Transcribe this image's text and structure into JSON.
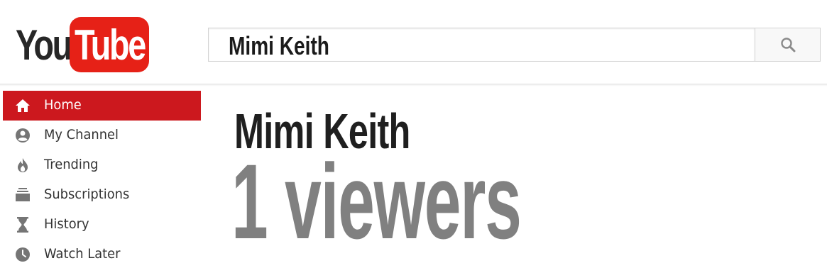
{
  "logo": {
    "you": "You",
    "tube": "Tube"
  },
  "search": {
    "value": "Mimi Keith",
    "button_icon": "search-icon"
  },
  "sidebar": {
    "items": [
      {
        "label": "Home",
        "icon": "home-icon",
        "active": true
      },
      {
        "label": "My Channel",
        "icon": "account-icon",
        "active": false
      },
      {
        "label": "Trending",
        "icon": "flame-icon",
        "active": false
      },
      {
        "label": "Subscriptions",
        "icon": "subscriptions-icon",
        "active": false
      },
      {
        "label": "History",
        "icon": "hourglass-icon",
        "active": false
      },
      {
        "label": "Watch Later",
        "icon": "clock-icon",
        "active": false
      }
    ]
  },
  "main": {
    "channel_name": "Mimi Keith",
    "viewers": "1 viewers"
  },
  "colors": {
    "brand_red": "#e62117",
    "active_nav": "#cc181e",
    "viewers_gray": "#808080",
    "icon_gray": "#757575"
  }
}
